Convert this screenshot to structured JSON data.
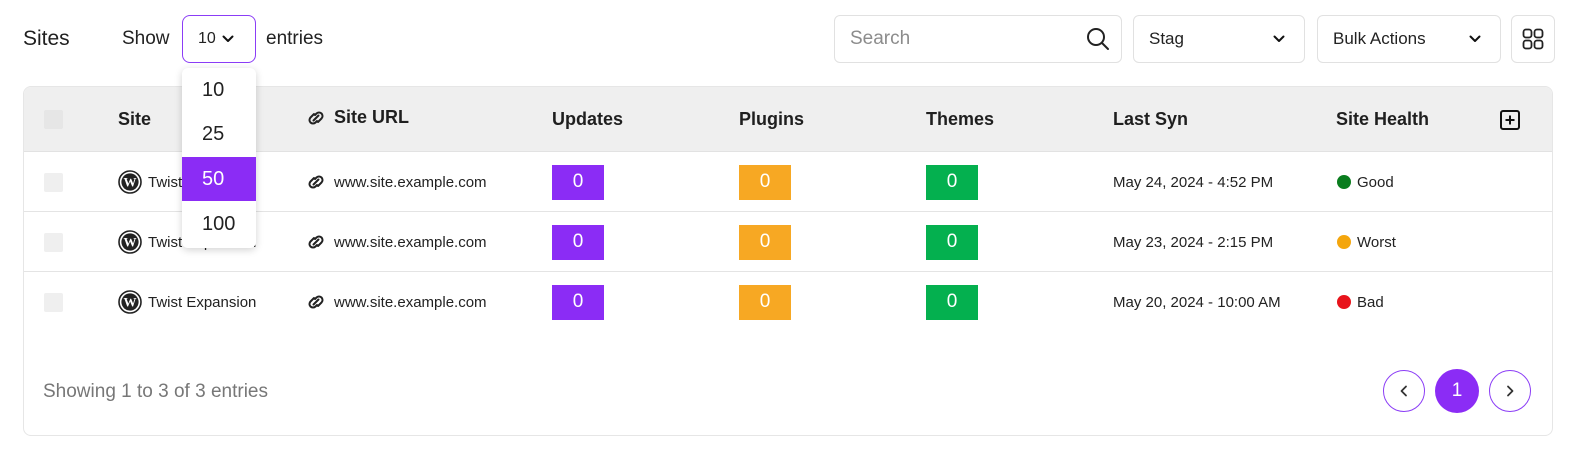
{
  "header": {
    "title": "Sites",
    "show_label": "Show",
    "entries_value": "10",
    "entries_label": "entries",
    "entries_options": [
      "10",
      "25",
      "50",
      "100"
    ],
    "entries_highlighted": "50",
    "search_placeholder": "Search",
    "filter_value": "Stag",
    "bulk_actions_label": "Bulk Actions",
    "grid_icon": "grid-view-icon"
  },
  "table": {
    "columns": [
      "Site",
      "Site URL",
      "Updates",
      "Plugins",
      "Themes",
      "Last Syn",
      "Site Health"
    ],
    "rows": [
      {
        "site": "Twist Expansion",
        "url": "www.site.example.com",
        "updates": "0",
        "plugins": "0",
        "themes": "0",
        "last_sync": "May 24, 2024 - 4:52 PM",
        "health": "Good",
        "health_color": "#0a7d1e"
      },
      {
        "site": "Twist Expansion",
        "url": "www.site.example.com",
        "updates": "0",
        "plugins": "0",
        "themes": "0",
        "last_sync": "May 23, 2024 - 2:15 PM",
        "health": "Worst",
        "health_color": "#f4a60d"
      },
      {
        "site": "Twist Expansion",
        "url": "www.site.example.com",
        "updates": "0",
        "plugins": "0",
        "themes": "0",
        "last_sync": "May 20, 2024 - 10:00 AM",
        "health": "Bad",
        "health_color": "#e8141b"
      }
    ]
  },
  "footer": {
    "info": "Showing 1 to 3 of 3 entries",
    "current_page": "1"
  },
  "colors": {
    "accent": "#8b2cf5",
    "updates": "#8b2cf5",
    "plugins": "#f7a823",
    "themes": "#04b04f"
  }
}
